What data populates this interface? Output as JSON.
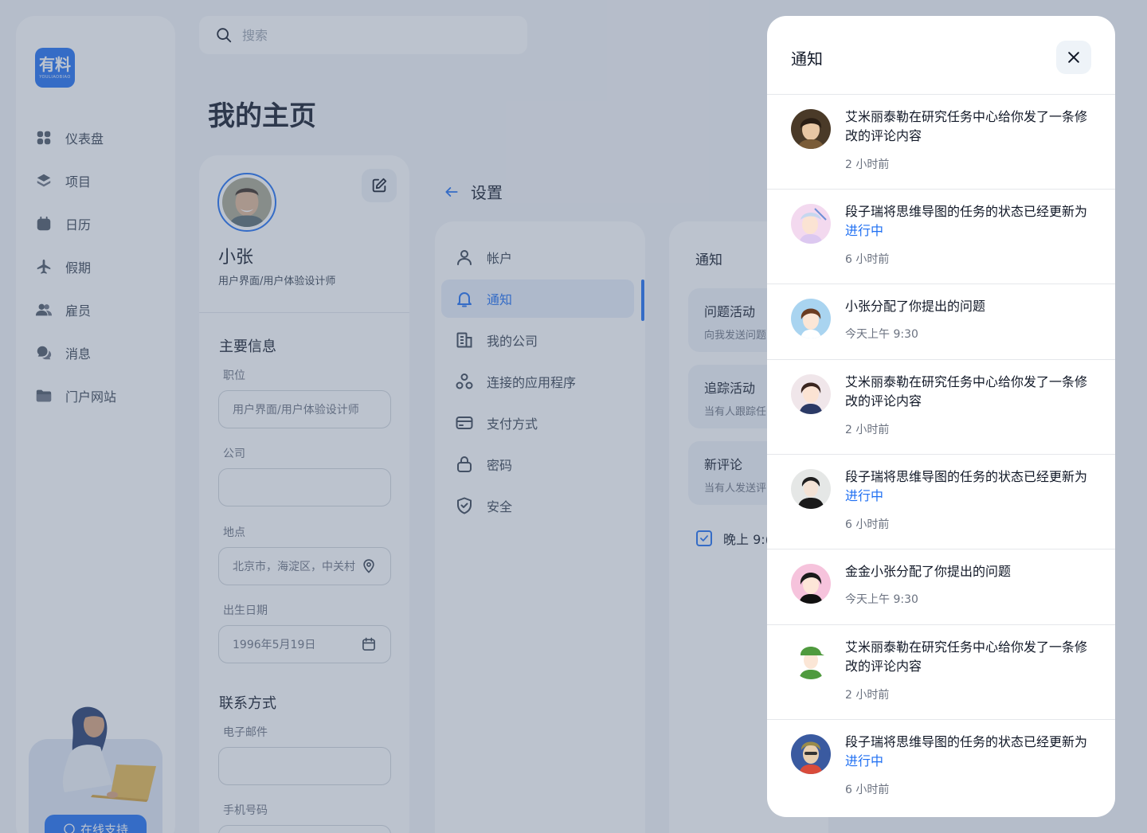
{
  "app": {
    "logo_text": "有料",
    "logo_sub": "YOULIAOBIAO"
  },
  "sidebar": {
    "items": [
      {
        "label": "仪表盘",
        "icon": "dashboard-icon"
      },
      {
        "label": "项目",
        "icon": "layers-icon"
      },
      {
        "label": "日历",
        "icon": "calendar-icon"
      },
      {
        "label": "假期",
        "icon": "airplane-icon"
      },
      {
        "label": "雇员",
        "icon": "users-icon"
      },
      {
        "label": "消息",
        "icon": "chat-icon"
      },
      {
        "label": "门户网站",
        "icon": "folder-icon"
      }
    ],
    "support_label": "在线支持"
  },
  "search": {
    "placeholder": "搜索"
  },
  "page": {
    "title": "我的主页"
  },
  "profile": {
    "name": "小张",
    "role": "用户界面/用户体验设计师",
    "main_info_title": "主要信息",
    "position_label": "职位",
    "position_value": "用户界面/用户体验设计师",
    "company_label": "公司",
    "company_value": "",
    "location_label": "地点",
    "location_value": "北京市，海淀区，中关村",
    "birth_label": "出生日期",
    "birth_value": "1996年5月19日",
    "contact_title": "联系方式",
    "email_label": "电子邮件",
    "email_value": "",
    "phone_label": "手机号码"
  },
  "settings": {
    "title": "设置",
    "items": [
      {
        "label": "帐户",
        "icon": "user-icon"
      },
      {
        "label": "通知",
        "icon": "bell-icon",
        "active": true
      },
      {
        "label": "我的公司",
        "icon": "building-icon"
      },
      {
        "label": "连接的应用程序",
        "icon": "apps-icon"
      },
      {
        "label": "支付方式",
        "icon": "credit-card-icon"
      },
      {
        "label": "密码",
        "icon": "lock-icon"
      },
      {
        "label": "安全",
        "icon": "shield-check-icon"
      }
    ]
  },
  "notification_settings": {
    "title": "通知",
    "cards": [
      {
        "title": "问题活动",
        "desc": "向我发送问题"
      },
      {
        "title": "追踪活动",
        "desc": "当有人跟踪任"
      },
      {
        "title": "新评论",
        "desc": "当有人发送评"
      }
    ],
    "time_label": "晚上 9:("
  },
  "panel": {
    "title": "通知",
    "notifications": [
      {
        "text": "艾米丽泰勒在研究任务中心给你发了一条修改的评论内容",
        "highlight": "",
        "time": "2 小时前"
      },
      {
        "text": "段子瑞将思维导图的任务的状态已经更新为",
        "highlight": "进行中",
        "time": "6 小时前"
      },
      {
        "text": "小张分配了你提出的问题",
        "highlight": "",
        "time": "今天上午 9:30"
      },
      {
        "text": "艾米丽泰勒在研究任务中心给你发了一条修改的评论内容",
        "highlight": "",
        "time": "2 小时前"
      },
      {
        "text": "段子瑞将思维导图的任务的状态已经更新为",
        "highlight": "进行中",
        "time": "6 小时前"
      },
      {
        "text": "金金小张分配了你提出的问题",
        "highlight": "",
        "time": "今天上午 9:30"
      },
      {
        "text": "艾米丽泰勒在研究任务中心给你发了一条修改的评论内容",
        "highlight": "",
        "time": "2 小时前"
      },
      {
        "text": "段子瑞将思维导图的任务的状态已经更新为",
        "highlight": "进行中",
        "time": "6 小时前"
      }
    ]
  },
  "colors": {
    "accent": "#1f6ff2",
    "overlay": "#586884"
  }
}
